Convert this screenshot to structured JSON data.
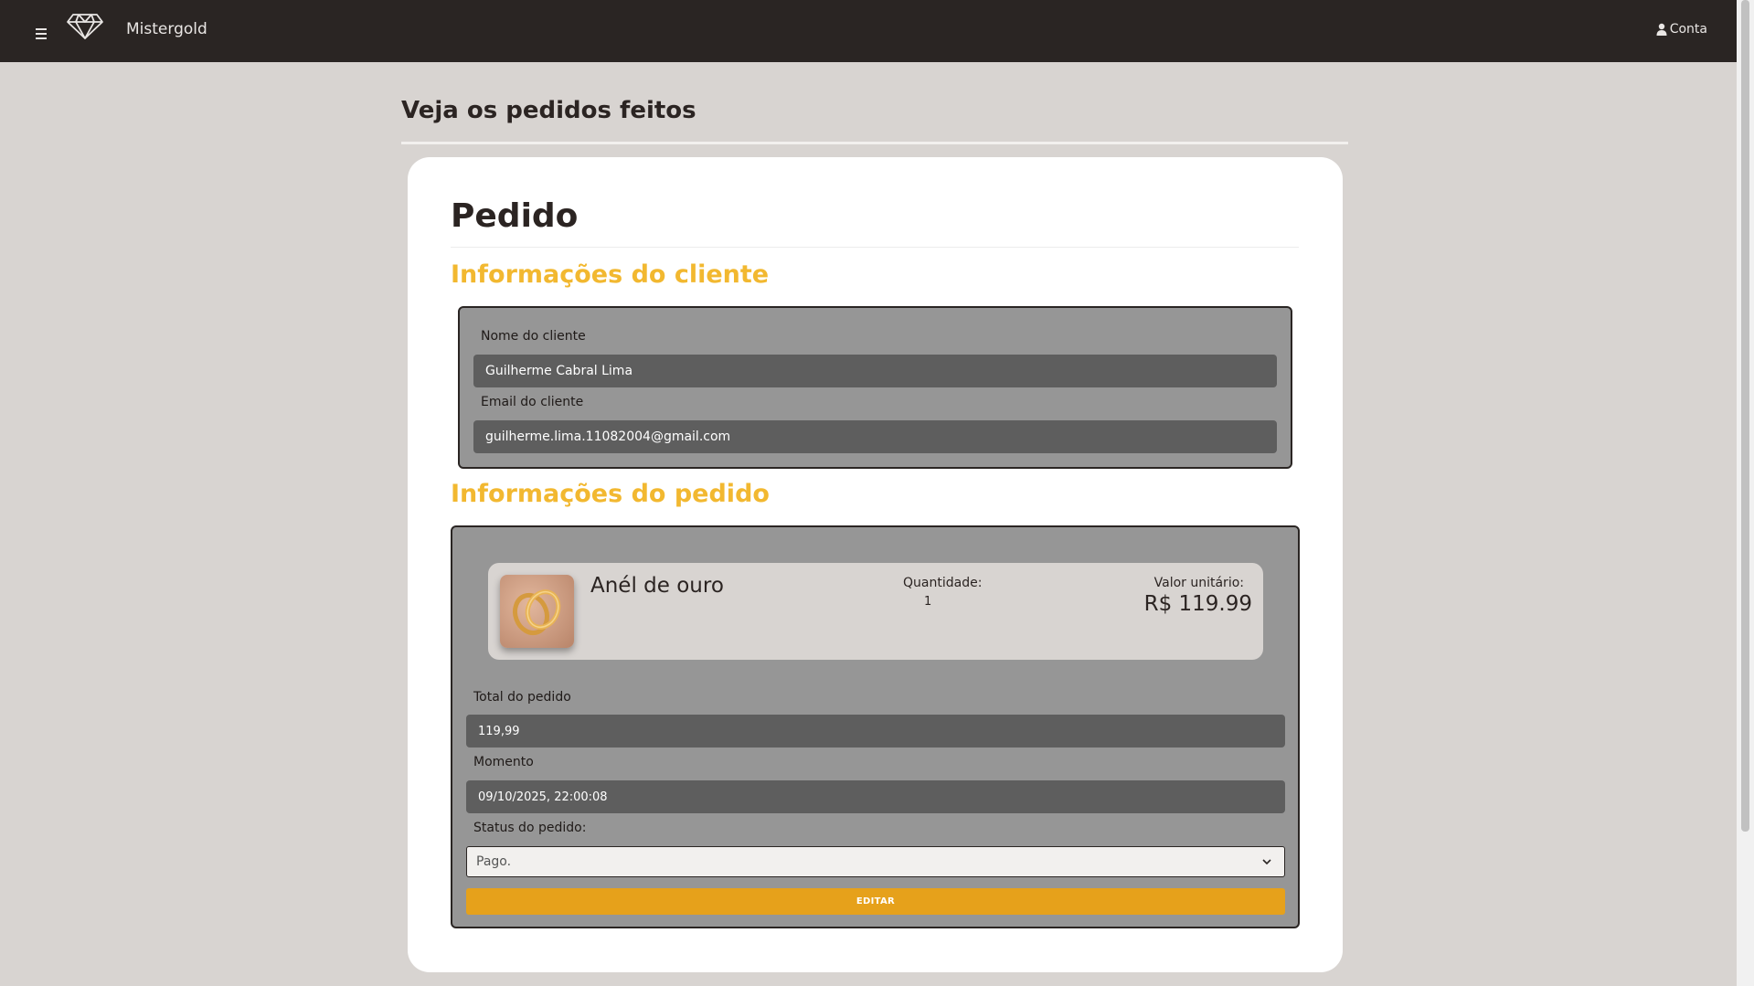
{
  "header": {
    "brand": "Mistergold",
    "account_label": "Conta"
  },
  "page": {
    "title": "Veja os pedidos feitos"
  },
  "order_card": {
    "title": "Pedido",
    "client_section_title": "Informações do cliente",
    "client_name_label": "Nome do cliente",
    "client_name_value": "Guilherme Cabral Lima",
    "client_email_label": "Email do cliente",
    "client_email_value": "guilherme.lima.11082004@gmail.com",
    "order_section_title": "Informações do pedido",
    "item": {
      "name": "Anél de ouro",
      "quantity_label": "Quantidade:",
      "quantity_value": "1",
      "unit_price_label": "Valor unitário:",
      "unit_price_value": "R$ 119.99"
    },
    "total_label": "Total do pedido",
    "total_value": "119,99",
    "moment_label": "Momento",
    "moment_value": "09/10/2025, 22:00:08",
    "status_label": "Status do pedido:",
    "status_value": "Pago.",
    "edit_button": "EDITAR"
  },
  "colors": {
    "navbar": "#2a2523",
    "background": "#d8d4d1",
    "accent": "#f2b830",
    "button": "#e6a11b"
  },
  "icons": [
    "hamburger-menu-icon",
    "diamond-logo-icon",
    "user-icon",
    "chevron-down-icon"
  ]
}
